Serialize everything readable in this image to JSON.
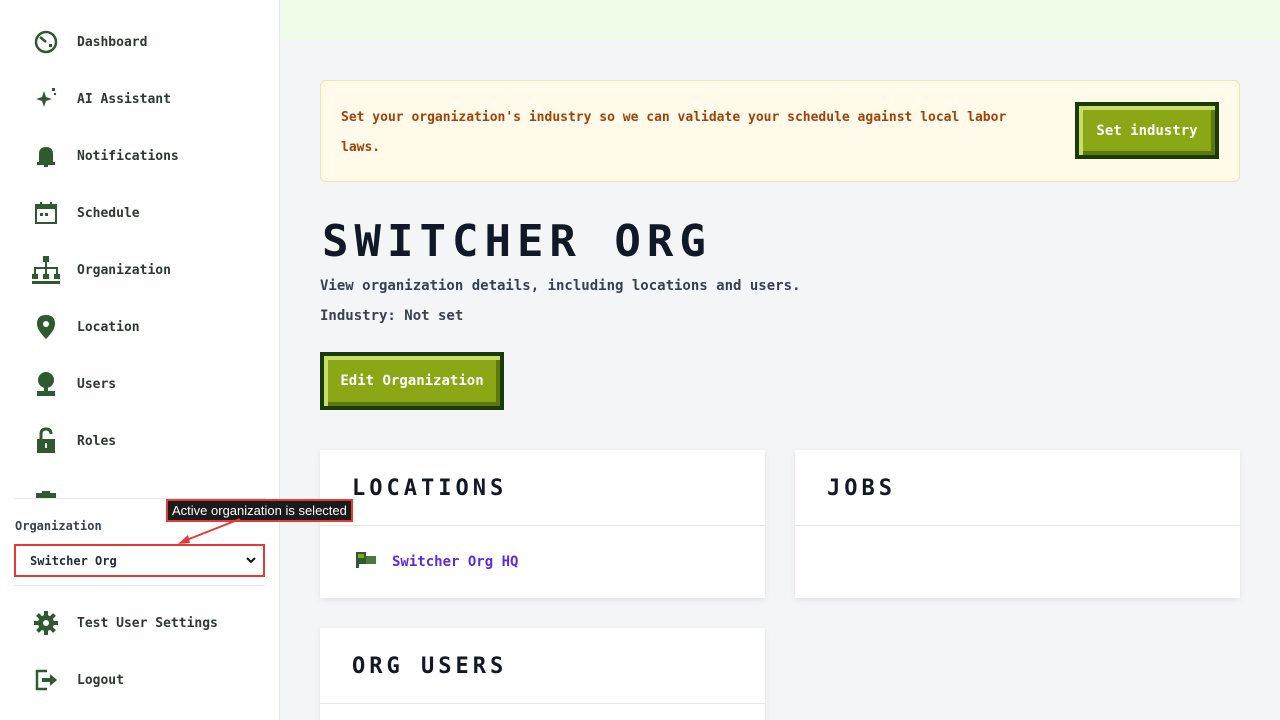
{
  "sidebar": {
    "items": [
      {
        "label": "Dashboard",
        "icon": "dashboard-icon"
      },
      {
        "label": "AI Assistant",
        "icon": "sparkle-icon"
      },
      {
        "label": "Notifications",
        "icon": "bell-icon"
      },
      {
        "label": "Schedule",
        "icon": "calendar-icon"
      },
      {
        "label": "Organization",
        "icon": "org-chart-icon"
      },
      {
        "label": "Location",
        "icon": "map-pin-icon"
      },
      {
        "label": "Users",
        "icon": "user-icon"
      },
      {
        "label": "Roles",
        "icon": "lock-icon"
      }
    ],
    "org_label": "Organization",
    "org_selected": "Switcher Org",
    "bottom_items": [
      {
        "label": "Test User Settings",
        "icon": "gear-icon"
      },
      {
        "label": "Logout",
        "icon": "logout-icon"
      }
    ]
  },
  "annotation": {
    "tooltip": "Active organization is selected"
  },
  "banner": {
    "message": "Set your organization's industry so we can validate your schedule against local labor laws.",
    "button_label": "Set industry"
  },
  "main": {
    "title": "SWITCHER ORG",
    "subtitle": "View organization details, including locations and users.",
    "industry": "Industry: Not set",
    "edit_button_label": "Edit Organization"
  },
  "cards": {
    "locations": {
      "title": "LOCATIONS",
      "items": [
        "Switcher Org HQ"
      ]
    },
    "jobs": {
      "title": "JOBS"
    },
    "users": {
      "title": "ORG USERS"
    }
  },
  "colors": {
    "accent_green": "#8aa815",
    "dark_green": "#1a3a06",
    "link_purple": "#5b2be0",
    "banner_text": "#a0430a",
    "annotation_red": "#e53935"
  }
}
